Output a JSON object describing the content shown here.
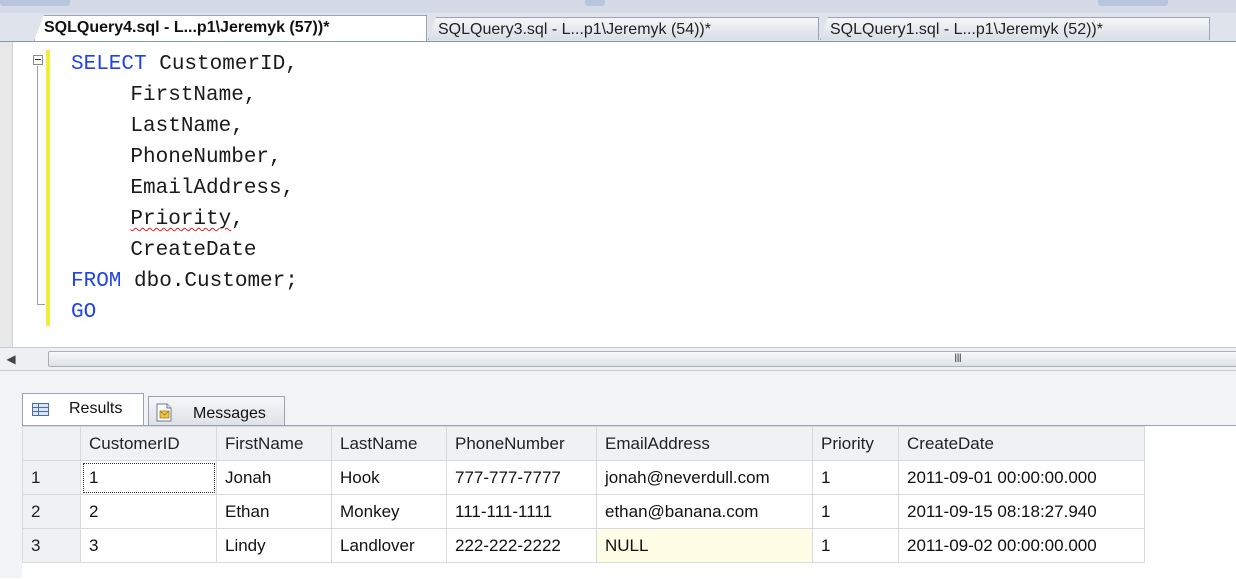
{
  "tabs": [
    {
      "label": "SQLQuery4.sql - L...p1\\Jeremyk (57))*",
      "active": true
    },
    {
      "label": "SQLQuery3.sql - L...p1\\Jeremyk (54))*",
      "active": false
    },
    {
      "label": "SQLQuery1.sql - L...p1\\Jeremyk (52))*",
      "active": false
    }
  ],
  "editor": {
    "lines": [
      {
        "keyword": "SELECT",
        "text": " CustomerID,"
      },
      {
        "keyword": "",
        "text": "    FirstName,"
      },
      {
        "keyword": "",
        "text": "    LastName,"
      },
      {
        "keyword": "",
        "text": "    PhoneNumber,"
      },
      {
        "keyword": "",
        "text": "    EmailAddress,"
      },
      {
        "keyword": "",
        "text": "    Priority,"
      },
      {
        "keyword": "",
        "text": "    CreateDate"
      },
      {
        "keyword": "FROM",
        "text": " dbo.Customer;"
      },
      {
        "keyword": "GO",
        "text": ""
      }
    ],
    "scrollbar_grip": "III"
  },
  "results_tabs": {
    "results_label": "Results",
    "messages_label": "Messages"
  },
  "grid": {
    "columns": [
      "CustomerID",
      "FirstName",
      "LastName",
      "PhoneNumber",
      "EmailAddress",
      "Priority",
      "CreateDate"
    ],
    "rows": [
      {
        "num": "1",
        "cells": [
          "1",
          "Jonah",
          "Hook",
          "777-777-7777",
          "jonah@neverdull.com",
          "1",
          "2011-09-01 00:00:00.000"
        ]
      },
      {
        "num": "2",
        "cells": [
          "2",
          "Ethan",
          "Monkey",
          "111-111-1111",
          "ethan@banana.com",
          "1",
          "2011-09-15 08:18:27.940"
        ]
      },
      {
        "num": "3",
        "cells": [
          "3",
          "Lindy",
          "Landlover",
          "222-222-2222",
          "NULL",
          "1",
          "2011-09-02 00:00:00.000"
        ]
      }
    ]
  },
  "colors": {
    "keyword": "#1e44e6",
    "change_bar": "#f3ec3a",
    "null_cell": "#fffde6"
  }
}
